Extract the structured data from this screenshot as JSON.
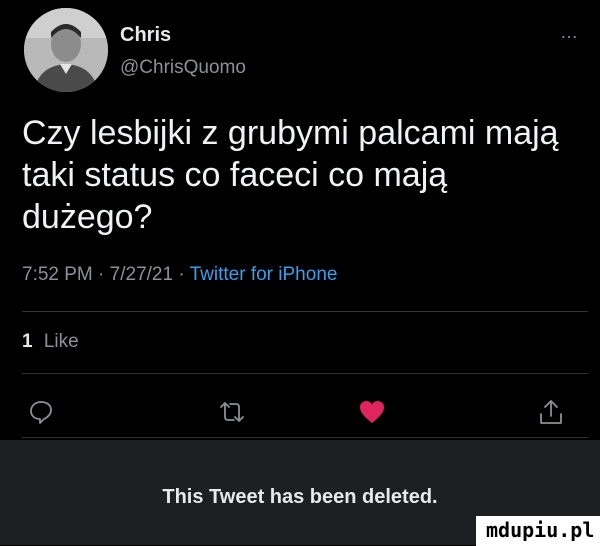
{
  "tweet": {
    "author_name": "Chris",
    "author_handle": "@ChrisQuomo",
    "more_label": "…",
    "text": "Czy lesbijki z grubymi palcami mają taki status co faceci co mają dużego?",
    "time": "7:52 PM",
    "date": "7/27/21",
    "source": "Twitter for iPhone",
    "separator": "·",
    "likes_count": "1",
    "likes_label": "Like"
  },
  "actions": {
    "icons": [
      "reply-icon",
      "retweet-icon",
      "like-icon",
      "share-icon"
    ],
    "like_color": "#e0245e"
  },
  "notice": {
    "deleted_text": "This Tweet has been deleted."
  },
  "watermark": {
    "text": "mdupiu.pl"
  },
  "colors": {
    "background": "#000000",
    "text": "#e7e9ea",
    "muted": "#8b9198",
    "link": "#3b9ee8",
    "divider": "#2f3336",
    "deleted_bar": "#1d1f23"
  }
}
